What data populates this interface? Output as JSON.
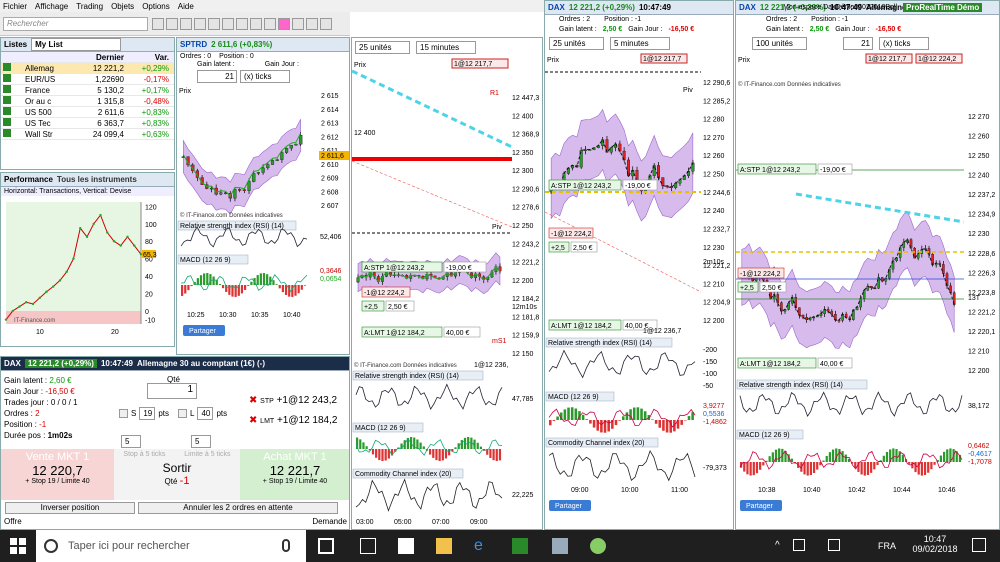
{
  "menu": [
    "Fichier",
    "Affichage",
    "Trading",
    "Objets",
    "Options",
    "Aide"
  ],
  "search_placeholder": "Rechercher",
  "lists": {
    "tab_label": "Listes",
    "list_name": "My List",
    "col_last": "Dernier",
    "col_var": "Var.",
    "rows": [
      {
        "name": "Allemag",
        "last": "12 221,2",
        "var": "+0,29%",
        "dir": "pos"
      },
      {
        "name": "EUR/US",
        "last": "1,22690",
        "var": "-0,17%",
        "dir": "neg"
      },
      {
        "name": "France",
        "last": "5 130,2",
        "var": "+0,17%",
        "dir": "pos"
      },
      {
        "name": "Or au c",
        "last": "1 315,8",
        "var": "-0,48%",
        "dir": "neg"
      },
      {
        "name": "US 500",
        "last": "2 611,6",
        "var": "+0,83%",
        "dir": "pos"
      },
      {
        "name": "US Tec",
        "last": "6 363,7",
        "var": "+0,83%",
        "dir": "pos"
      },
      {
        "name": "Wall Str",
        "last": "24 099,4",
        "var": "+0,63%",
        "dir": "pos"
      }
    ]
  },
  "performance": {
    "tab1": "Performance",
    "tab2": "Tous les instruments",
    "label": "Horizontal: Transactions, Vertical: Devise",
    "source": "IT-Finance.com",
    "yticks": [
      "120",
      "100",
      "80",
      "60",
      "40",
      "20",
      "0",
      "-10"
    ],
    "xticks": [
      "10",
      "20"
    ],
    "value_box": "65,3",
    "chart_data": {
      "type": "line",
      "x": [
        1,
        2,
        3,
        4,
        5,
        6,
        7,
        8,
        9,
        10,
        11,
        12,
        13,
        14,
        15,
        16,
        17,
        18,
        19,
        20,
        21
      ],
      "values": [
        -10,
        0,
        5,
        10,
        8,
        15,
        22,
        28,
        35,
        45,
        60,
        95,
        85,
        100,
        110,
        90,
        80,
        75,
        85,
        75,
        65
      ],
      "ylim": [
        -15,
        125
      ],
      "xlabel": "",
      "ylabel": ""
    }
  },
  "sptrd": {
    "title": "SPTRD",
    "change": "2 611,6 (+0,83%)",
    "orders": "Ordres : 0",
    "position": "Position : 0",
    "gain_latent": "Gain latent :",
    "gain_jour": "Gain Jour :",
    "ticks_value": "21",
    "ticks_unit": "(x) ticks",
    "price_label": "Prix",
    "price_ticks": [
      "2 615",
      "2 614",
      "2 613",
      "2 612",
      "2 611",
      "2 610",
      "2 609",
      "2 608",
      "2 607"
    ],
    "current_price": "2 611,6",
    "times": [
      "10:25",
      "10:30",
      "10:35",
      "10:40"
    ],
    "source": "© IT-Finance.com Données indicatives",
    "rsi_label": "Relative strength index (RSI) (14)",
    "rsi_value": "52,406",
    "macd_label": "MACD (12 26 9)",
    "macd_values": [
      "0,3646",
      "0,0654"
    ],
    "share": "Partager"
  },
  "dax_order": {
    "title": "DAX",
    "change": "12 221,2 (+0,29%)",
    "time": "10:47:49",
    "desc": "Allemagne 30 au comptant (1€) (-)",
    "gain_latent_lbl": "Gain latent :",
    "gain_latent": "2,60 €",
    "gain_jour_lbl": "Gain Jour :",
    "gain_jour": "-16,50 €",
    "trades_jour": "Trades jour : 0 / 0 / 1",
    "ordres_lbl": "Ordres :",
    "ordres": "2",
    "position_lbl": "Position :",
    "position": "-1",
    "duree_lbl": "Durée pos :",
    "duree": "1m02s",
    "qte_lbl": "Qté",
    "qte": "1",
    "s_lbl": "S",
    "s_pts": "19",
    "l_lbl": "L",
    "l_pts": "40",
    "pts": "pts",
    "stp_lbl": "STP",
    "stp": "+1@12 243,2",
    "lmt_lbl": "LMT",
    "lmt": "+1@12 184,2",
    "step_left": "5",
    "step_right": "5",
    "vente_lbl": "Vente MKT 1",
    "vente_price": "12 220,7",
    "vente_sub": "+ Stop 19 / Limite 40",
    "stop5": "Stop à 5 ticks",
    "limit5": "Limite à 5 ticks",
    "sortir": "Sortir",
    "sortir_qte_lbl": "Qté",
    "sortir_qte": "-1",
    "achat_lbl": "Achat MKT 1",
    "achat_price": "12 221,7",
    "achat_sub": "+ Stop 19 / Limite 40",
    "inverser": "Inverser position",
    "annuler": "Annuler les 2 ordres en attente",
    "offre": "Offre",
    "demande": "Demande"
  },
  "dax_mid": {
    "units": "25 unités",
    "interval": "15 minutes",
    "price_label": "Prix",
    "top_box": "1@12 217,7",
    "price_ticks": [
      "12 447,3",
      "12 400",
      "12 368,9",
      "12 350",
      "12 300",
      "12 290,6",
      "12 278,6",
      "12 250",
      "12 243,2",
      "12 221,2",
      "12 200",
      "12 184,2",
      "12 181,8",
      "12 159,9",
      "12 150"
    ],
    "r1": "R1",
    "piv": "Piv",
    "s1": "mS1",
    "label_12400": "12 400",
    "stp_line": "A:STP 1@12 243,2",
    "stp_val": "-19,00 €",
    "pos_line": "-1@12 224,2",
    "pos_val": "+2,5",
    "pos_val2": "2,50 €",
    "lmt_line": "A:LMT 1@12 184,2",
    "lmt_val": "40,00 €",
    "elapsed": "12m10s",
    "bottom_box": "1@12 236,",
    "source": "© IT-Finance.com Données indicatives",
    "rsi_label": "Relative strength index (RSI) (14)",
    "rsi_value": "47,785",
    "macd_label": "MACD (12 26 9)",
    "cci_label": "Commodity Channel index (20)",
    "cci_value": "22,225",
    "times": [
      "03:00",
      "05:00",
      "07:00",
      "09:00"
    ],
    "share": "Partager"
  },
  "dax_5m": {
    "title": "DAX",
    "change": "12 221,2 (+0,29%)",
    "time": "10:47:49",
    "orders": "Ordres : 2",
    "position": "Position : -1",
    "gain_latent_lbl": "Gain latent :",
    "gain_latent": "2,50 €",
    "gain_jour_lbl": "Gain Jour :",
    "gain_jour": "-16,50 €",
    "units": "25 unités",
    "interval": "5 minutes",
    "price_label": "Prix",
    "top_box": "1@12 217,7",
    "price_ticks": [
      "12 290,6",
      "12 285,2",
      "12 280",
      "12 270",
      "12 260",
      "12 250",
      "12 244,6",
      "12 240",
      "12 232,7",
      "12 230",
      "12 221,2",
      "12 210",
      "12 204,9",
      "12 200"
    ],
    "piv": "Piv",
    "stp_line": "A:STP 1@12 243,2",
    "stp_val": "-19,00 €",
    "pos_line": "-1@12 224,2",
    "pos_val": "+2,5",
    "pos_val2": "2,50 €",
    "elapsed": "2m10s",
    "lmt_line": "A:LMT 1@12 184,2",
    "lmt_val": "40,00 €",
    "bottom_box": "1@12 236,7",
    "rsi_label": "Relative strength index (RSI) (14)",
    "rsi_ticks": [
      "-200",
      "-150",
      "-100",
      "-50"
    ],
    "macd_label": "MACD (12 26 9)",
    "macd_values": [
      "3,9277",
      "0,5536",
      "-1,4862"
    ],
    "cci_label": "Commodity Channel index (20)",
    "cci_value": "-79,373",
    "times": [
      "09:00",
      "10:00",
      "11:00"
    ],
    "share": "Partager"
  },
  "dax_right": {
    "title": "DAX",
    "change": "12 221,2 (+0,29%)",
    "time": "10:47:49",
    "desc": "Allemagne 30 au compt",
    "orders": "Ordres : 2",
    "position": "Position : -1",
    "gain_latent_lbl": "Gain latent :",
    "gain_latent": "2,50 €",
    "gain_jour_lbl": "Gain Jour :",
    "gain_jour": "-16,50 €",
    "units": "100 unités",
    "ticks_value": "21",
    "ticks_unit": "(x) ticks",
    "price_label": "Prix",
    "top_box": "1@12 217,7",
    "top_box2": "1@12 224,2",
    "source": "© IT-Finance.com Données indicatives",
    "price_ticks": [
      "12 270",
      "12 260",
      "12 250",
      "12 240",
      "12 237,2",
      "12 234,9",
      "12 230",
      "12 228,6",
      "12 226,3",
      "12 223,8",
      "12 221,2",
      "12 220,1",
      "12 210",
      "12 200"
    ],
    "stp_line": "A:STP 1@12 243,2",
    "stp_val": "-19,00 €",
    "pos_line": "-1@12 224,2",
    "pos_val": "+2,5",
    "pos_val2": "2,50 €",
    "lmt_line": "A:LMT 1@12 184,2",
    "lmt_val": "40,00 €",
    "elapsed": "13T",
    "rsi_label": "Relative strength index (RSI) (14)",
    "rsi_value": "38,172",
    "macd_label": "MACD (12 26 9)",
    "macd_values": [
      "0,6462",
      "-0,4617",
      "-1,7078"
    ],
    "times": [
      "10:38",
      "10:40",
      "10:42",
      "10:44",
      "10:46"
    ],
    "share": "Partager"
  },
  "top_right": {
    "space": "Mon espace DaxDémo05022018Boll",
    "brand": "ProRealTime",
    "demo": "Démo"
  },
  "taskbar": {
    "search": "Taper ici pour rechercher",
    "lang": "FRA",
    "time": "10:47",
    "date": "09/02/2018"
  }
}
